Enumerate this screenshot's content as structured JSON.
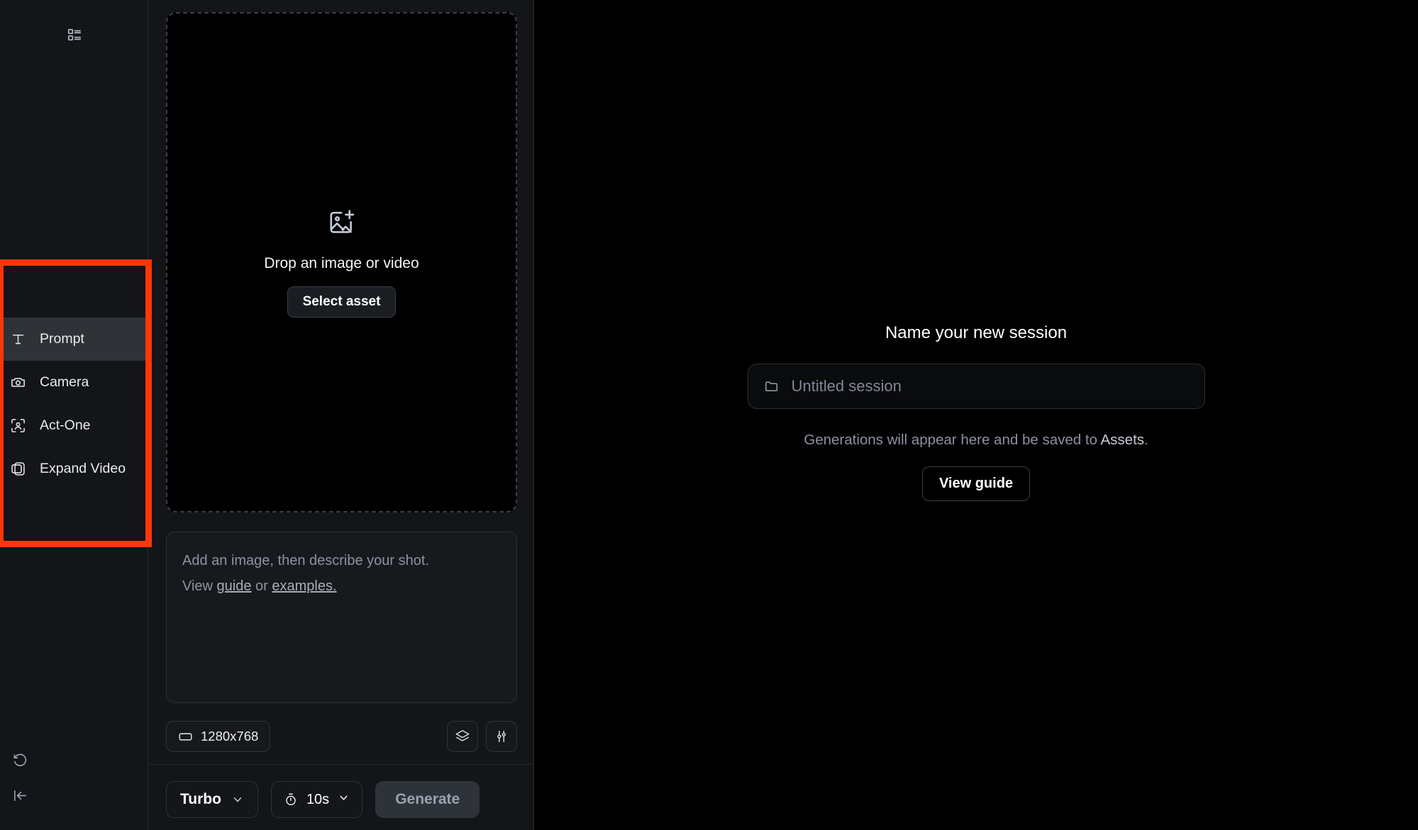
{
  "rail": {
    "top_icon": "list-view-icon",
    "menu": [
      {
        "label": "Prompt",
        "icon": "text-icon",
        "active": true
      },
      {
        "label": "Camera",
        "icon": "camera-icon",
        "active": false
      },
      {
        "label": "Act-One",
        "icon": "face-scan-icon",
        "active": false
      },
      {
        "label": "Expand Video",
        "icon": "expand-video-icon",
        "active": false
      }
    ],
    "bottom": [
      {
        "icon": "history-icon"
      },
      {
        "icon": "collapse-panel-icon"
      }
    ]
  },
  "dropzone": {
    "icon": "image-plus-icon",
    "label": "Drop an image or video",
    "button": "Select asset"
  },
  "prompt": {
    "line1": "Add an image, then describe your shot.",
    "line2_prefix": "View ",
    "link_guide": "guide",
    "line2_mid": " or ",
    "link_examples": "examples."
  },
  "options": {
    "resolution": "1280x768",
    "resolution_icon": "aspect-ratio-icon",
    "layers_icon": "layers-icon",
    "settings_icon": "sliders-icon"
  },
  "generate_bar": {
    "model": "Turbo",
    "duration": "10s",
    "duration_icon": "stopwatch-icon",
    "generate_label": "Generate"
  },
  "session": {
    "title": "Name your new session",
    "folder_icon": "folder-icon",
    "input_value": "",
    "input_placeholder": "Untitled session",
    "note_prefix": "Generations will appear here and be saved to ",
    "note_link": "Assets",
    "note_suffix": ".",
    "view_guide": "View guide"
  },
  "annotation": {
    "color": "#fc3709"
  }
}
